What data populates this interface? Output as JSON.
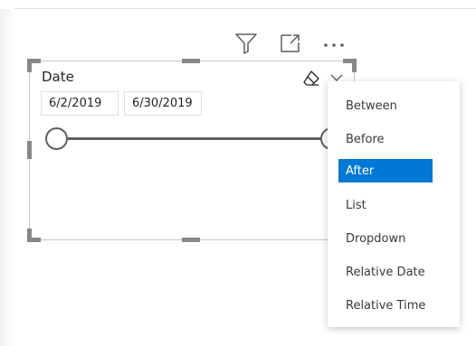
{
  "slicer": {
    "title": "Date",
    "start_date": "6/2/2019",
    "end_date": "6/30/2019",
    "icons": {
      "filter": "filter-icon",
      "focus": "focus-mode-icon",
      "more": "more-options-icon",
      "eraser": "eraser-icon",
      "chevron": "chevron-down-icon"
    }
  },
  "menu": {
    "items": [
      {
        "label": "Between"
      },
      {
        "label": "Before"
      },
      {
        "label": "After"
      },
      {
        "label": "List"
      },
      {
        "label": "Dropdown"
      },
      {
        "label": "Relative Date"
      },
      {
        "label": "Relative Time"
      }
    ],
    "selected_label": "After"
  },
  "colors": {
    "accent": "#0078d4",
    "frame": "#8a8886",
    "track": "#605e5c"
  }
}
